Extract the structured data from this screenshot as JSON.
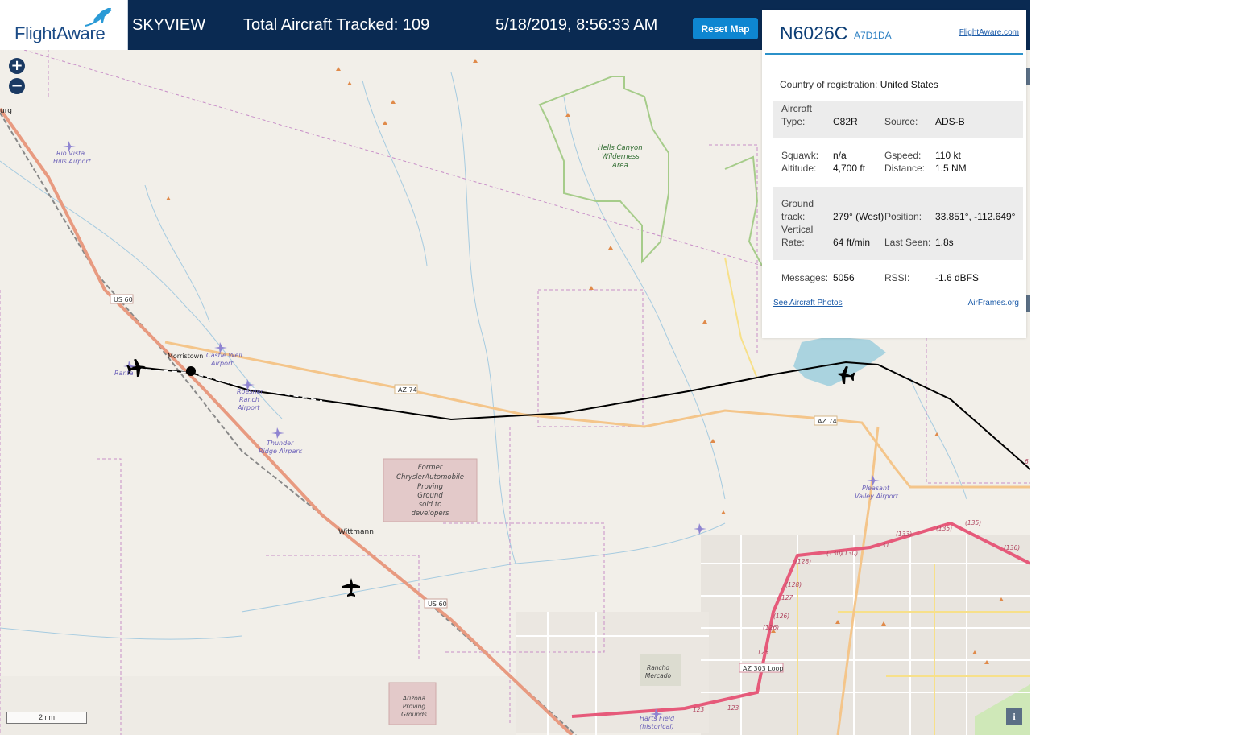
{
  "header": {
    "logo": "FlightAware",
    "product": "SKYVIEW",
    "total_tracked": "Total Aircraft Tracked: 109",
    "datetime": "5/18/2019, 8:56:33 AM",
    "reset_button": "Reset Map"
  },
  "map_controls": {
    "zoom_in": "+",
    "zoom_out": "−",
    "scale": "2 nm",
    "info": "i"
  },
  "aircraft_panel": {
    "ident": "N6026C",
    "hex": "A7D1DA",
    "flightaware_link": "FlightAware.com",
    "country_label": "Country of registration:",
    "country_value": "United States",
    "aircraft_type_label": "Aircraft Type:",
    "aircraft_type_value": "C82R",
    "source_label": "Source:",
    "source_value": "ADS-B",
    "squawk_label": "Squawk:",
    "squawk_value": "n/a",
    "altitude_label": "Altitude:",
    "altitude_value": "4,700 ft",
    "gspeed_label": "Gspeed:",
    "gspeed_value": "110 kt",
    "distance_label": "Distance:",
    "distance_value": "1.5 NM",
    "ground_track_label": "Ground track:",
    "ground_track_value": "279° (West)",
    "position_label": "Position:",
    "position_value": "33.851°, -112.649°",
    "vertical_rate_label": "Vertical Rate:",
    "vertical_rate_value": "64 ft/min",
    "last_seen_label": "Last Seen:",
    "last_seen_value": "1.8s",
    "messages_label": "Messages:",
    "messages_value": "5056",
    "rssi_label": "RSSI:",
    "rssi_value": "-1.6 dBFS",
    "photos_link": "See Aircraft Photos",
    "airframes_link": "AirFrames.org"
  },
  "map_labels": {
    "hells_canyon_1": "Hells Canyon",
    "hells_canyon_2": "Wilderness",
    "hells_canyon_3": "Area",
    "rio_vista_1": "Rio Vista",
    "rio_vista_2": "Hills Airport",
    "morristown": "Morristown",
    "castle_well_1": "Castle Well",
    "castle_well_2": "Airport",
    "roesner_1": "Roesner",
    "roesner_2": "Ranch",
    "roesner_3": "Airport",
    "thunder_1": "Thunder",
    "thunder_2": "Ridge Airpark",
    "chrysler_1": "Former",
    "chrysler_2": "ChryslerAutomobile",
    "chrysler_3": "Proving",
    "chrysler_4": "Ground",
    "chrysler_5": "sold to",
    "chrysler_6": "developers",
    "wittmann": "Wittmann",
    "pleasant_1": "Pleasant",
    "pleasant_2": "Valley Airport",
    "rancho_1": "Rancho",
    "rancho_2": "Mercado",
    "arizona_pg_1": "Arizona",
    "arizona_pg_2": "Proving",
    "arizona_pg_3": "Grounds",
    "harts_1": "Harts Field",
    "harts_2": "(historical)",
    "us60_a": "US 60",
    "us60_b": "US 60",
    "az74_a": "AZ 74",
    "az74_b": "AZ 74",
    "az303": "AZ 303 Loop",
    "edge_burg": "urg",
    "ranta": "Ranta",
    "r127": "127",
    "r128a": "(128)",
    "r128b": "(128)",
    "r126a": "(126)",
    "r126b": "(126)",
    "r125": "125",
    "r130a": "(130)",
    "r130b": "(130)",
    "r131": "131",
    "r133": "(133)",
    "r135a": "(135)",
    "r135b": "(135)",
    "r136": "(136)",
    "r123a": "123",
    "r123b": "123",
    "r6": "6"
  }
}
